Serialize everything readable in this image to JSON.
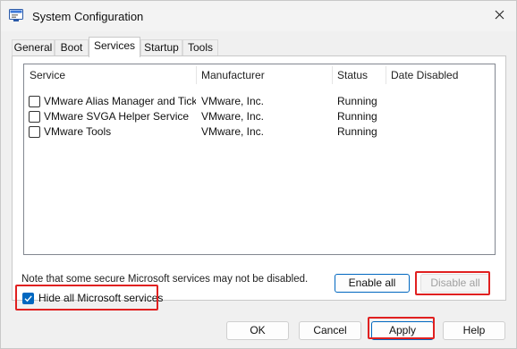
{
  "window": {
    "title": "System Configuration"
  },
  "tabs": [
    {
      "label": "General"
    },
    {
      "label": "Boot"
    },
    {
      "label": "Services",
      "active": true
    },
    {
      "label": "Startup"
    },
    {
      "label": "Tools"
    }
  ],
  "services_list": {
    "columns": [
      "Service",
      "Manufacturer",
      "Status",
      "Date Disabled"
    ],
    "rows": [
      {
        "service": "VMware Alias Manager and Ticke...",
        "manufacturer": "VMware, Inc.",
        "status": "Running",
        "date_disabled": "",
        "checked": false
      },
      {
        "service": "VMware SVGA Helper Service",
        "manufacturer": "VMware, Inc.",
        "status": "Running",
        "date_disabled": "",
        "checked": false
      },
      {
        "service": "VMware Tools",
        "manufacturer": "VMware, Inc.",
        "status": "Running",
        "date_disabled": "",
        "checked": false
      }
    ]
  },
  "note": "Note that some secure Microsoft services may not be disabled.",
  "buttons": {
    "enable_all": "Enable all",
    "disable_all": "Disable all",
    "ok": "OK",
    "cancel": "Cancel",
    "apply": "Apply",
    "help": "Help"
  },
  "hide_ms": {
    "label": "Hide all Microsoft services",
    "checked": true
  },
  "colors": {
    "accent": "#0067c0",
    "highlight": "#e02020"
  }
}
